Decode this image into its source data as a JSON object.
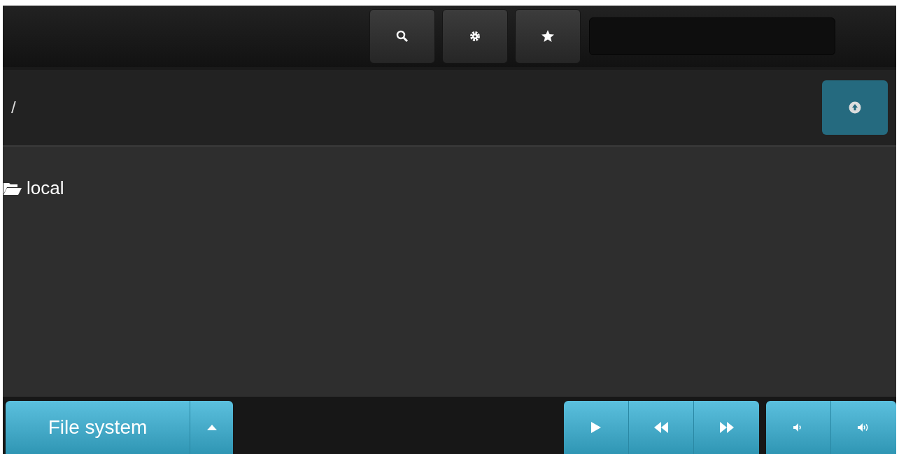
{
  "path": "/",
  "entries": [
    {
      "name": "local",
      "kind": "folder"
    }
  ],
  "footer": {
    "source_button": "File system"
  }
}
